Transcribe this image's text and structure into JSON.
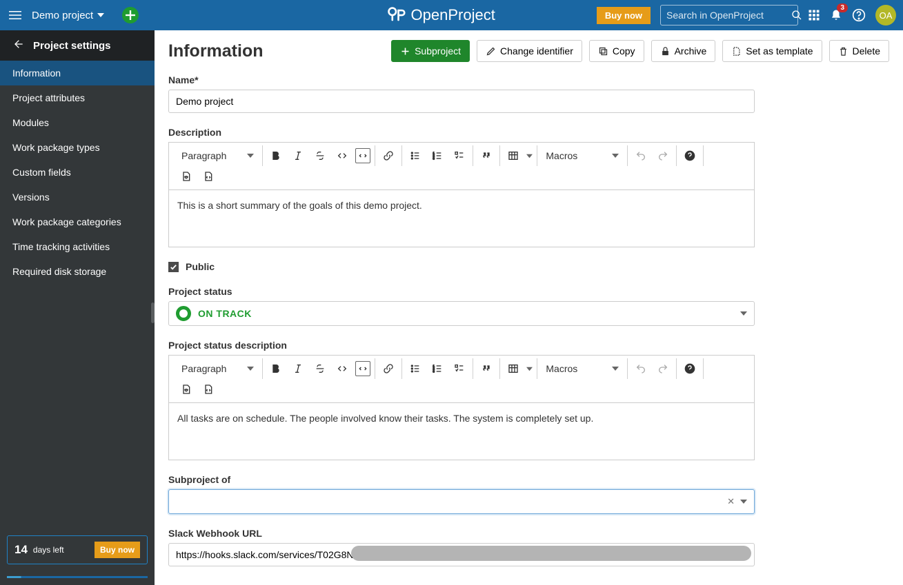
{
  "topbar": {
    "project_name": "Demo project",
    "logo_text": "OpenProject",
    "buy_now": "Buy now",
    "search_placeholder": "Search in OpenProject",
    "notifications_count": "3",
    "avatar_initials": "OA"
  },
  "sidebar": {
    "header": "Project settings",
    "items": [
      "Information",
      "Project attributes",
      "Modules",
      "Work package types",
      "Custom fields",
      "Versions",
      "Work package categories",
      "Time tracking activities",
      "Required disk storage"
    ],
    "active_index": 0,
    "trial": {
      "days": "14",
      "label": "days left",
      "button": "Buy now"
    }
  },
  "page": {
    "title": "Information",
    "actions": {
      "subproject": "Subproject",
      "change_identifier": "Change identifier",
      "copy": "Copy",
      "archive": "Archive",
      "set_template": "Set as template",
      "delete": "Delete"
    }
  },
  "form": {
    "name_label": "Name*",
    "name_value": "Demo project",
    "description_label": "Description",
    "description_body": "This is a short summary of the goals of this demo project.",
    "public_label": "Public",
    "public_checked": true,
    "status_label": "Project status",
    "status_value": "ON TRACK",
    "status_desc_label": "Project status description",
    "status_desc_body": "All tasks are on schedule. The people involved know their tasks. The system is completely set up.",
    "subproject_label": "Subproject of",
    "subproject_value": "",
    "webhook_label": "Slack Webhook URL",
    "webhook_value": "https://hooks.slack.com/services/T02G8N"
  },
  "editor": {
    "heading_default": "Paragraph",
    "macros": "Macros"
  }
}
